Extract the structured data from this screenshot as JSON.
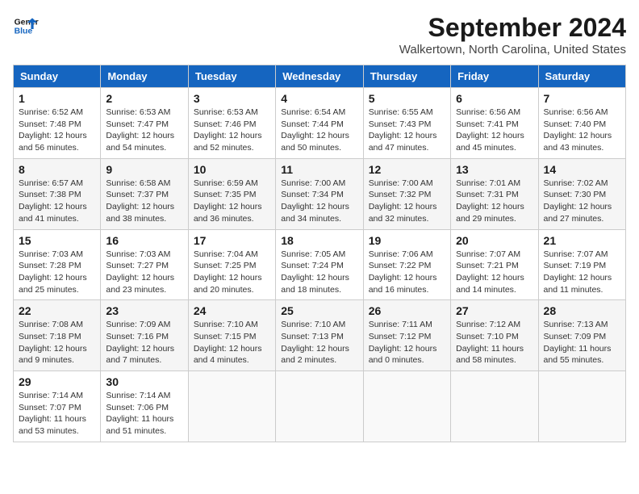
{
  "logo": {
    "line1": "General",
    "line2": "Blue"
  },
  "title": "September 2024",
  "location": "Walkertown, North Carolina, United States",
  "weekdays": [
    "Sunday",
    "Monday",
    "Tuesday",
    "Wednesday",
    "Thursday",
    "Friday",
    "Saturday"
  ],
  "weeks": [
    [
      {
        "day": "1",
        "detail": "Sunrise: 6:52 AM\nSunset: 7:48 PM\nDaylight: 12 hours\nand 56 minutes."
      },
      {
        "day": "2",
        "detail": "Sunrise: 6:53 AM\nSunset: 7:47 PM\nDaylight: 12 hours\nand 54 minutes."
      },
      {
        "day": "3",
        "detail": "Sunrise: 6:53 AM\nSunset: 7:46 PM\nDaylight: 12 hours\nand 52 minutes."
      },
      {
        "day": "4",
        "detail": "Sunrise: 6:54 AM\nSunset: 7:44 PM\nDaylight: 12 hours\nand 50 minutes."
      },
      {
        "day": "5",
        "detail": "Sunrise: 6:55 AM\nSunset: 7:43 PM\nDaylight: 12 hours\nand 47 minutes."
      },
      {
        "day": "6",
        "detail": "Sunrise: 6:56 AM\nSunset: 7:41 PM\nDaylight: 12 hours\nand 45 minutes."
      },
      {
        "day": "7",
        "detail": "Sunrise: 6:56 AM\nSunset: 7:40 PM\nDaylight: 12 hours\nand 43 minutes."
      }
    ],
    [
      {
        "day": "8",
        "detail": "Sunrise: 6:57 AM\nSunset: 7:38 PM\nDaylight: 12 hours\nand 41 minutes."
      },
      {
        "day": "9",
        "detail": "Sunrise: 6:58 AM\nSunset: 7:37 PM\nDaylight: 12 hours\nand 38 minutes."
      },
      {
        "day": "10",
        "detail": "Sunrise: 6:59 AM\nSunset: 7:35 PM\nDaylight: 12 hours\nand 36 minutes."
      },
      {
        "day": "11",
        "detail": "Sunrise: 7:00 AM\nSunset: 7:34 PM\nDaylight: 12 hours\nand 34 minutes."
      },
      {
        "day": "12",
        "detail": "Sunrise: 7:00 AM\nSunset: 7:32 PM\nDaylight: 12 hours\nand 32 minutes."
      },
      {
        "day": "13",
        "detail": "Sunrise: 7:01 AM\nSunset: 7:31 PM\nDaylight: 12 hours\nand 29 minutes."
      },
      {
        "day": "14",
        "detail": "Sunrise: 7:02 AM\nSunset: 7:30 PM\nDaylight: 12 hours\nand 27 minutes."
      }
    ],
    [
      {
        "day": "15",
        "detail": "Sunrise: 7:03 AM\nSunset: 7:28 PM\nDaylight: 12 hours\nand 25 minutes."
      },
      {
        "day": "16",
        "detail": "Sunrise: 7:03 AM\nSunset: 7:27 PM\nDaylight: 12 hours\nand 23 minutes."
      },
      {
        "day": "17",
        "detail": "Sunrise: 7:04 AM\nSunset: 7:25 PM\nDaylight: 12 hours\nand 20 minutes."
      },
      {
        "day": "18",
        "detail": "Sunrise: 7:05 AM\nSunset: 7:24 PM\nDaylight: 12 hours\nand 18 minutes."
      },
      {
        "day": "19",
        "detail": "Sunrise: 7:06 AM\nSunset: 7:22 PM\nDaylight: 12 hours\nand 16 minutes."
      },
      {
        "day": "20",
        "detail": "Sunrise: 7:07 AM\nSunset: 7:21 PM\nDaylight: 12 hours\nand 14 minutes."
      },
      {
        "day": "21",
        "detail": "Sunrise: 7:07 AM\nSunset: 7:19 PM\nDaylight: 12 hours\nand 11 minutes."
      }
    ],
    [
      {
        "day": "22",
        "detail": "Sunrise: 7:08 AM\nSunset: 7:18 PM\nDaylight: 12 hours\nand 9 minutes."
      },
      {
        "day": "23",
        "detail": "Sunrise: 7:09 AM\nSunset: 7:16 PM\nDaylight: 12 hours\nand 7 minutes."
      },
      {
        "day": "24",
        "detail": "Sunrise: 7:10 AM\nSunset: 7:15 PM\nDaylight: 12 hours\nand 4 minutes."
      },
      {
        "day": "25",
        "detail": "Sunrise: 7:10 AM\nSunset: 7:13 PM\nDaylight: 12 hours\nand 2 minutes."
      },
      {
        "day": "26",
        "detail": "Sunrise: 7:11 AM\nSunset: 7:12 PM\nDaylight: 12 hours\nand 0 minutes."
      },
      {
        "day": "27",
        "detail": "Sunrise: 7:12 AM\nSunset: 7:10 PM\nDaylight: 11 hours\nand 58 minutes."
      },
      {
        "day": "28",
        "detail": "Sunrise: 7:13 AM\nSunset: 7:09 PM\nDaylight: 11 hours\nand 55 minutes."
      }
    ],
    [
      {
        "day": "29",
        "detail": "Sunrise: 7:14 AM\nSunset: 7:07 PM\nDaylight: 11 hours\nand 53 minutes."
      },
      {
        "day": "30",
        "detail": "Sunrise: 7:14 AM\nSunset: 7:06 PM\nDaylight: 11 hours\nand 51 minutes."
      },
      {
        "day": "",
        "detail": ""
      },
      {
        "day": "",
        "detail": ""
      },
      {
        "day": "",
        "detail": ""
      },
      {
        "day": "",
        "detail": ""
      },
      {
        "day": "",
        "detail": ""
      }
    ]
  ]
}
